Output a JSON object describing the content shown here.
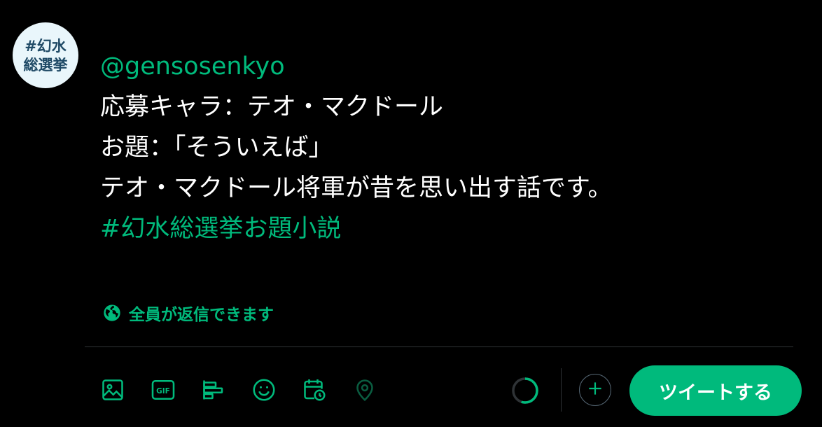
{
  "avatar": {
    "text": "#幻水\n総選挙"
  },
  "tweet": {
    "lines": [
      "@gensosenkyo",
      "応募キャラ：テオ・マクドール",
      "お題：「そういえば」",
      "テオ・マクドール将軍が昔を思い出す話です。",
      "#幻水総選挙お題小説"
    ]
  },
  "reply_setting": {
    "label": "全員が返信できます",
    "icon": "globe-icon"
  },
  "toolbar": {
    "icons": [
      "image-icon",
      "gif-icon",
      "poll-icon",
      "emoji-icon",
      "schedule-icon",
      "location-icon"
    ],
    "progress_fraction": 0.55,
    "tweet_button_label": "ツイートする"
  },
  "colors": {
    "accent": "#00ba7c",
    "background": "#000000",
    "text": "#ffffff",
    "divider": "#2f3336",
    "muted": "#536471"
  }
}
